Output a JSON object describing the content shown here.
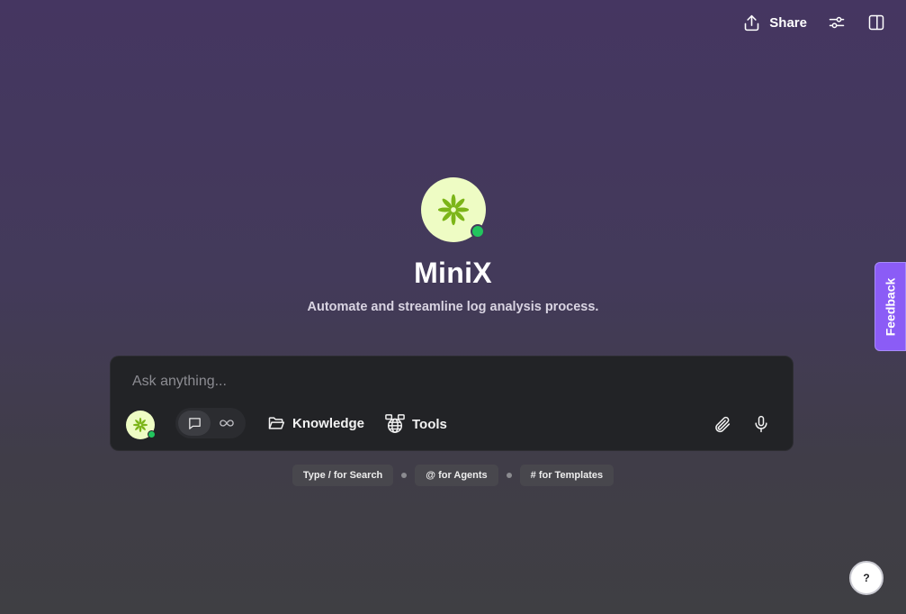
{
  "header": {
    "share_label": "Share",
    "icons": [
      "share-icon",
      "settings-sliders-icon",
      "split-panel-icon"
    ]
  },
  "agent": {
    "name": "MiniX",
    "description": "Automate and streamline log analysis process.",
    "avatar_icon": "asterisk-flower-icon",
    "status": "online"
  },
  "composer": {
    "placeholder": "Ask anything...",
    "modes": [
      "chat-bubble-icon",
      "infinity-icon"
    ],
    "active_mode": "chat-bubble-icon",
    "knowledge_label": "Knowledge",
    "tools_label": "Tools",
    "right_icons": [
      "paperclip-icon",
      "microphone-icon"
    ]
  },
  "hints": [
    "Type / for Search",
    "@ for Agents",
    "# for Templates"
  ],
  "feedback": {
    "label": "Feedback"
  },
  "help": {
    "label": "?"
  },
  "colors": {
    "background_top": "#453661",
    "background_bottom": "#3f3f43",
    "composer_bg": "#222326",
    "avatar_bg": "#eefcc4",
    "avatar_icon": "#7cb518",
    "status_online": "#22c55e",
    "feedback_bg": "#8b5cf6"
  }
}
